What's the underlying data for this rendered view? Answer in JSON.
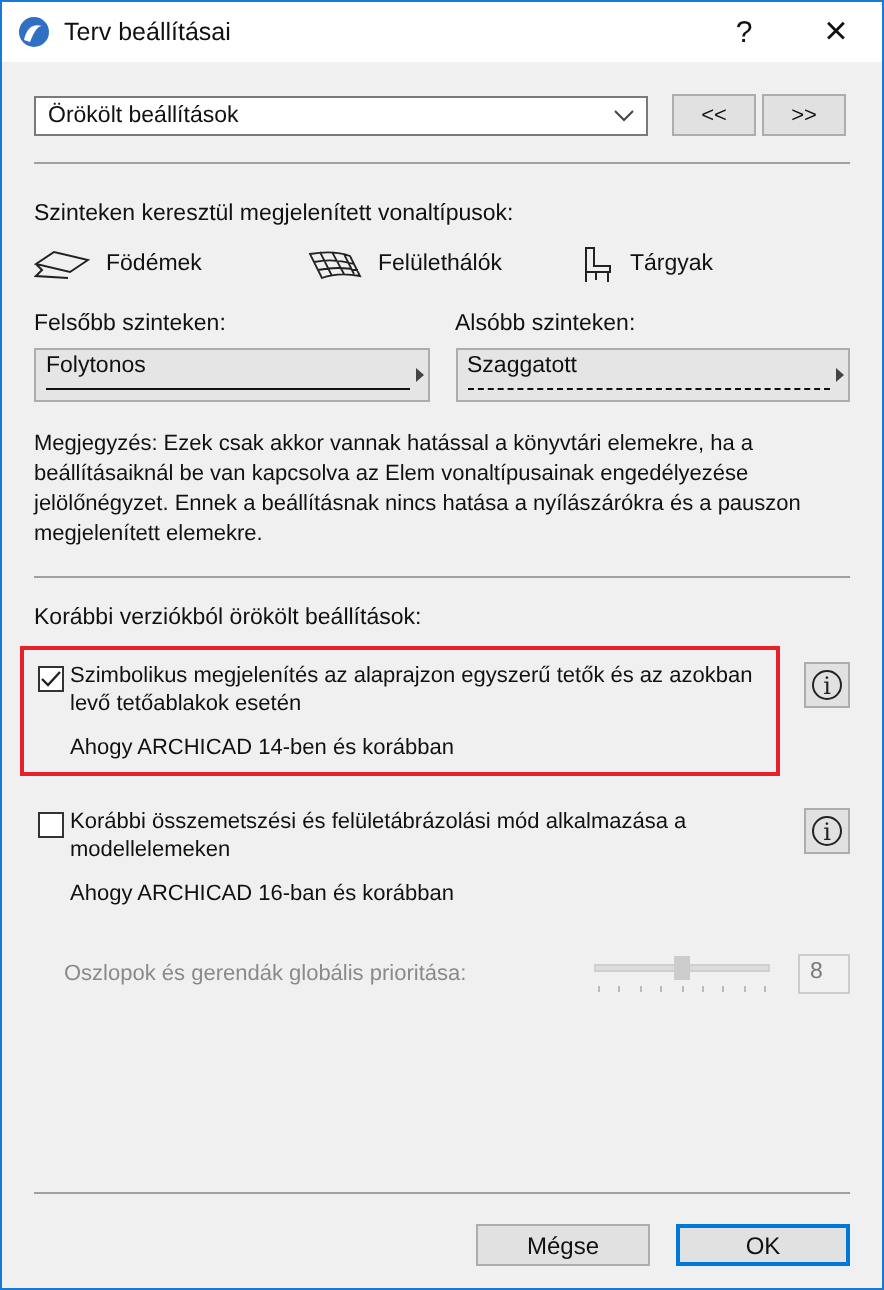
{
  "window": {
    "title": "Terv beállításai",
    "help": "?",
    "close": "×"
  },
  "preset": {
    "value": "Örökölt beállítások",
    "prev": "<<",
    "next": ">>"
  },
  "linetypes": {
    "heading": "Szinteken keresztül megjelenített vonaltípusok:",
    "element_types": [
      {
        "kind": "slab",
        "label": "Födémek"
      },
      {
        "kind": "mesh",
        "label": "Felülethálók"
      },
      {
        "kind": "object",
        "label": "Tárgyak"
      }
    ],
    "pickers": [
      {
        "label": "Felsőbb szinteken:",
        "value": "Folytonos",
        "dashed": false
      },
      {
        "label": "Alsóbb szinteken:",
        "value": "Szaggatott",
        "dashed": true
      }
    ],
    "note": "Megjegyzés: Ezek csak akkor vannak hatással a könyvtári elemekre, ha a beállításaiknál be van kapcsolva az Elem vonaltípusainak engedélyezése jelölőnégyzet. Ennek a beállításnak nincs hatása a nyílászárókra és a pauszon megjelenített elemekre."
  },
  "legacy": {
    "heading": "Korábbi verziókból örökölt beállítások:",
    "options": [
      {
        "label": "Szimbolikus megjelenítés az alaprajzon egyszerű tetők és az azokban levő tetőablakok esetén",
        "checked": true,
        "highlighted": true,
        "info": "i",
        "note": "Ahogy ARCHICAD 14-ben és korábban"
      },
      {
        "label": "Korábbi összemetszési és felületábrázolási mód alkalmazása a modellelemeken",
        "checked": false,
        "highlighted": false,
        "info": "i",
        "note": "Ahogy ARCHICAD 16-ban és korábban"
      }
    ],
    "priority": {
      "label": "Oszlopok és gerendák globális prioritása:",
      "level": 0.5,
      "value": "8",
      "disabled": true
    }
  },
  "buttons": [
    {
      "label": "Mégse",
      "default": false
    },
    {
      "label": "OK",
      "default": true
    }
  ]
}
